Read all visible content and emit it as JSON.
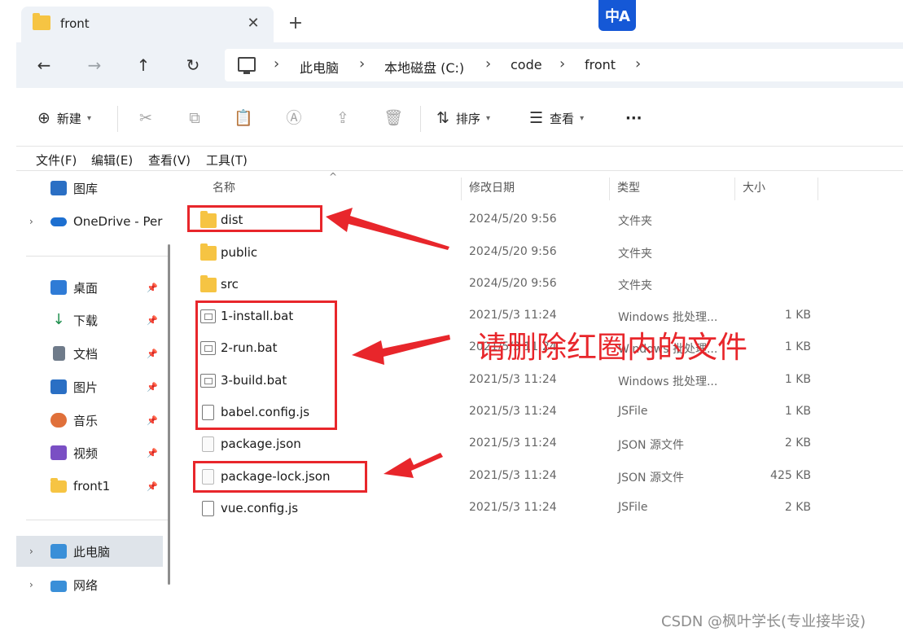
{
  "tab": {
    "title": "front",
    "close_label": "✕",
    "new_label": "+"
  },
  "translate_badge": "中A",
  "nav": {
    "back": "←",
    "forward": "→",
    "up": "↑",
    "refresh": "↻"
  },
  "breadcrumb": [
    "此电脑",
    "本地磁盘 (C:)",
    "code",
    "front"
  ],
  "breadcrumb_sep": "›",
  "toolbar": {
    "new_label": "新建",
    "sort_label": "排序",
    "view_label": "查看",
    "more_label": "···"
  },
  "menubar": [
    "文件(F)",
    "编辑(E)",
    "查看(V)",
    "工具(T)"
  ],
  "sidebar": {
    "top_item": "图库",
    "onedrive": "OneDrive - Per",
    "quick": [
      {
        "label": "桌面",
        "color": "#2f7bd6"
      },
      {
        "label": "下载",
        "color": "#1f8f4e"
      },
      {
        "label": "文档",
        "color": "#6f7b8a"
      },
      {
        "label": "图片",
        "color": "#2a6fc4"
      },
      {
        "label": "音乐",
        "color": "#e0703a"
      },
      {
        "label": "视频",
        "color": "#7a4fc4"
      },
      {
        "label": "front1",
        "color": "#f6c443"
      }
    ],
    "this_pc": "此电脑",
    "network": "网络"
  },
  "columns": {
    "name": "名称",
    "date": "修改日期",
    "type": "类型",
    "size": "大小"
  },
  "files": [
    {
      "name": "dist",
      "date": "2024/5/20 9:56",
      "type": "文件夹",
      "size": "",
      "kind": "folder"
    },
    {
      "name": "public",
      "date": "2024/5/20 9:56",
      "type": "文件夹",
      "size": "",
      "kind": "folder"
    },
    {
      "name": "src",
      "date": "2024/5/20 9:56",
      "type": "文件夹",
      "size": "",
      "kind": "folder"
    },
    {
      "name": "1-install.bat",
      "date": "2021/5/3 11:24",
      "type": "Windows 批处理...",
      "size": "1 KB",
      "kind": "bat"
    },
    {
      "name": "2-run.bat",
      "date": "2021/5/3 11:24",
      "type": "Windows 批处理...",
      "size": "1 KB",
      "kind": "bat"
    },
    {
      "name": "3-build.bat",
      "date": "2021/5/3 11:24",
      "type": "Windows 批处理...",
      "size": "1 KB",
      "kind": "bat"
    },
    {
      "name": "babel.config.js",
      "date": "2021/5/3 11:24",
      "type": "JSFile",
      "size": "1 KB",
      "kind": "doc"
    },
    {
      "name": "package.json",
      "date": "2021/5/3 11:24",
      "type": "JSON 源文件",
      "size": "2 KB",
      "kind": "json"
    },
    {
      "name": "package-lock.json",
      "date": "2021/5/3 11:24",
      "type": "JSON 源文件",
      "size": "425 KB",
      "kind": "json"
    },
    {
      "name": "vue.config.js",
      "date": "2021/5/3 11:24",
      "type": "JSFile",
      "size": "2 KB",
      "kind": "doc"
    }
  ],
  "annotation": {
    "text": "请删除红圈内的文件",
    "color": "#e8262b"
  },
  "watermark": "CSDN @枫叶学长(专业接毕设)"
}
